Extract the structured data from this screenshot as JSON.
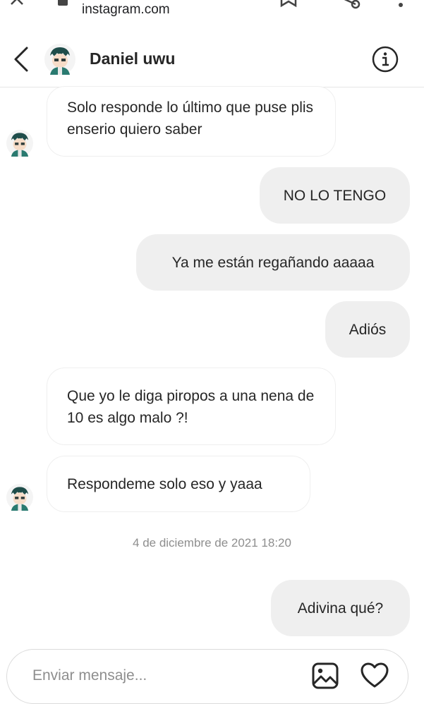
{
  "browser": {
    "url": "instagram.com"
  },
  "header": {
    "contact_name": "Daniel uwu"
  },
  "messages": [
    {
      "side": "in",
      "text": "Solo responde lo último que puse plis enserio quiero saber"
    },
    {
      "side": "out",
      "text": "NO LO TENGO"
    },
    {
      "side": "out",
      "text": "Ya me están regañando aaaaa"
    },
    {
      "side": "out",
      "text": "Adiós"
    },
    {
      "side": "in",
      "text": "Que yo le diga piropos a una nena de 10 es algo malo ?!"
    },
    {
      "side": "in",
      "text": "Respondeme solo eso y yaaa"
    },
    {
      "side": "out",
      "text": "Adivina qué?"
    }
  ],
  "timestamp": "4 de diciembre de 2021 18:20",
  "composer": {
    "placeholder": "Enviar mensaje..."
  },
  "icons": {
    "back": "chevron-left-icon",
    "info": "info-icon",
    "gallery": "image-icon",
    "like": "heart-icon"
  },
  "colors": {
    "outgoing_bubble": "#efefef",
    "incoming_border": "#efefef",
    "text": "#262626",
    "muted": "#8e8e8e"
  }
}
